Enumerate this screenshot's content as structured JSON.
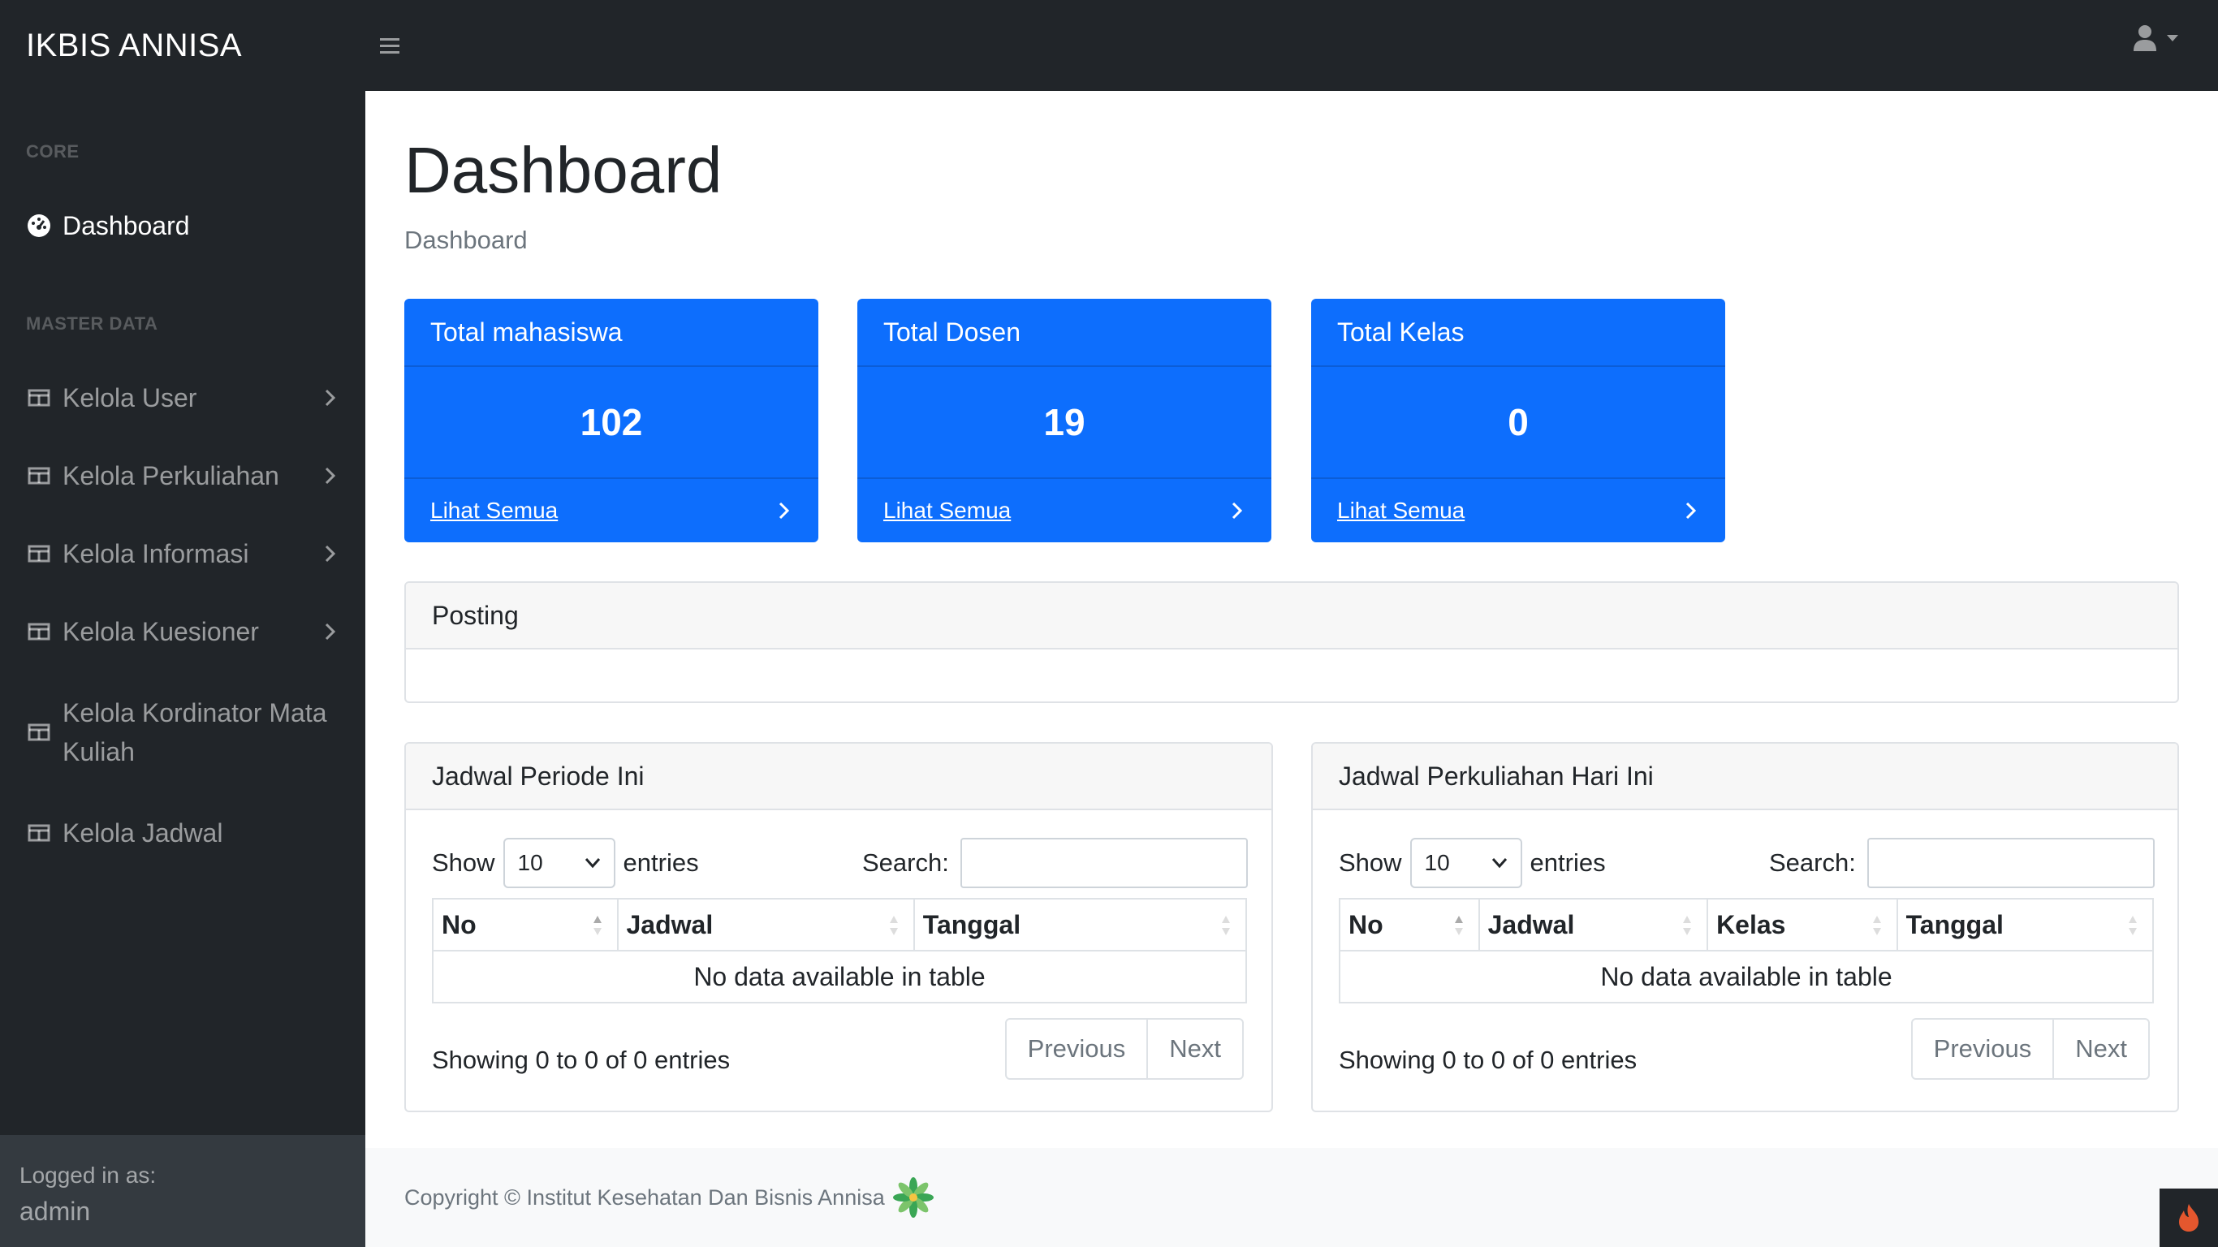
{
  "brand": "IKBIS ANNISA",
  "sidebar": {
    "headings": [
      "CORE",
      "MASTER DATA"
    ],
    "items": [
      {
        "label": "Dashboard",
        "icon": "gauge-icon",
        "active": true,
        "has_chevron": false
      },
      {
        "label": "Kelola User",
        "icon": "table-icon",
        "has_chevron": true
      },
      {
        "label": "Kelola Perkuliahan",
        "icon": "table-icon",
        "has_chevron": true
      },
      {
        "label": "Kelola Informasi",
        "icon": "table-icon",
        "has_chevron": true
      },
      {
        "label": "Kelola Kuesioner",
        "icon": "table-icon",
        "has_chevron": true
      },
      {
        "label": "Kelola Kordinator Mata Kuliah",
        "icon": "table-icon",
        "has_chevron": false
      },
      {
        "label": "Kelola Jadwal",
        "icon": "table-icon",
        "has_chevron": false
      }
    ],
    "footer": {
      "label": "Logged in as:",
      "user": "admin"
    }
  },
  "page": {
    "title": "Dashboard",
    "breadcrumb": "Dashboard"
  },
  "cards": [
    {
      "title": "Total mahasiswa",
      "value": "102",
      "link": "Lihat Semua"
    },
    {
      "title": "Total Dosen",
      "value": "19",
      "link": "Lihat Semua"
    },
    {
      "title": "Total Kelas",
      "value": "0",
      "link": "Lihat Semua"
    }
  ],
  "posting": {
    "title": "Posting"
  },
  "tables": [
    {
      "title": "Jadwal Periode Ini",
      "show_label": "Show",
      "entries_value": "10",
      "entries_label": "entries",
      "search_label": "Search:",
      "columns": [
        "No",
        "Jadwal",
        "Tanggal"
      ],
      "empty": "No data available in table",
      "info": "Showing 0 to 0 of 0 entries",
      "prev": "Previous",
      "next": "Next"
    },
    {
      "title": "Jadwal Perkuliahan Hari Ini",
      "show_label": "Show",
      "entries_value": "10",
      "entries_label": "entries",
      "search_label": "Search:",
      "columns": [
        "No",
        "Jadwal",
        "Kelas",
        "Tanggal"
      ],
      "empty": "No data available in table",
      "info": "Showing 0 to 0 of 0 entries",
      "prev": "Previous",
      "next": "Next"
    }
  ],
  "footer": {
    "copyright": "Copyright © Institut Kesehatan Dan Bisnis Annisa"
  },
  "colors": {
    "primary": "#0d6efd",
    "dark": "#212529",
    "sidebar_footer": "#343a40",
    "logo_green": "#3aa655",
    "badge_flame": "#e4572e"
  }
}
